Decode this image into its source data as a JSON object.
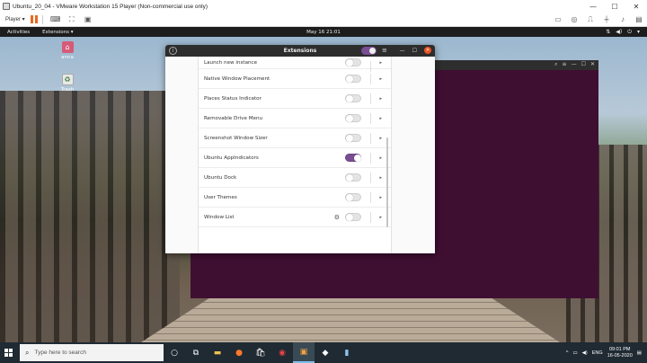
{
  "vmware": {
    "title": "Ubuntu_20_04 - VMware Workstation 15 Player (Non-commercial use only)",
    "player_menu": "Player ▾",
    "minimize": "—",
    "maximize": "☐",
    "close": "✕"
  },
  "ubuntu": {
    "activities": "Activities",
    "app_menu": "Extensions ▾",
    "clock": "May 16  21:01",
    "desktop_icons": [
      {
        "label": "anna"
      },
      {
        "label": "Trash"
      }
    ]
  },
  "extensions_window": {
    "title": "Extensions",
    "info": "i",
    "menu": "≡",
    "minimize": "—",
    "maximize": "☐",
    "close": "✕",
    "items": [
      {
        "name": "Launch new instance",
        "enabled": false,
        "arrow": "▸"
      },
      {
        "name": "Native Window Placement",
        "enabled": false,
        "arrow": "▸"
      },
      {
        "name": "Places Status Indicator",
        "enabled": false,
        "arrow": "▸"
      },
      {
        "name": "Removable Drive Menu",
        "enabled": false,
        "arrow": "▸"
      },
      {
        "name": "Screenshot Window Sizer",
        "enabled": false,
        "arrow": "▸"
      },
      {
        "name": "Ubuntu AppIndicators",
        "enabled": true,
        "arrow": "▸"
      },
      {
        "name": "Ubuntu Dock",
        "enabled": false,
        "arrow": "▸"
      },
      {
        "name": "User Themes",
        "enabled": false,
        "arrow": "▸"
      },
      {
        "name": "Window List",
        "enabled": false,
        "arrow": "▸"
      }
    ]
  },
  "taskbar": {
    "search_placeholder": "Type here to search",
    "language": "ENG",
    "time": "09:01 PM",
    "date": "16-05-2020",
    "colors": {
      "bar": "#1f2a33",
      "accent": "#7fbce8"
    }
  },
  "colors": {
    "ubuntu_purple": "#3f0f32",
    "toggle_on": "#7b4d92",
    "close_orange": "#e95420"
  }
}
